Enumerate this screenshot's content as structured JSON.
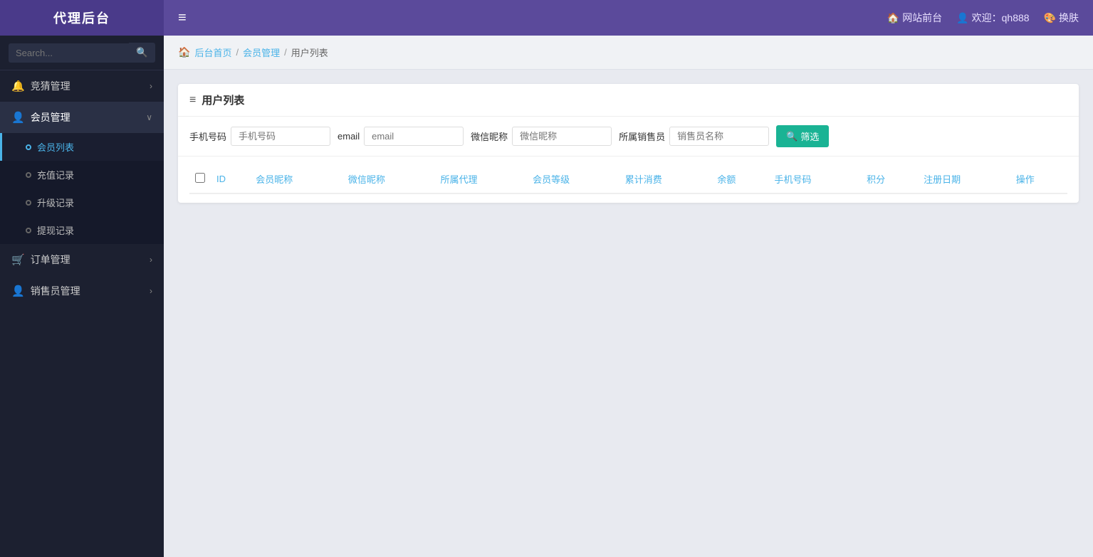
{
  "app": {
    "title": "代理后台"
  },
  "header": {
    "toggle_icon": "≡",
    "website_front": "网站前台",
    "welcome": "欢迎：qh888",
    "switch": "换肤"
  },
  "sidebar": {
    "search_placeholder": "Search...",
    "nav_items": [
      {
        "id": "jingsai",
        "label": "竞猜管理",
        "icon": "🔔",
        "has_arrow": true,
        "active": false
      },
      {
        "id": "huiyuan",
        "label": "会员管理",
        "icon": "👤",
        "has_arrow": true,
        "active": true,
        "children": [
          {
            "id": "huiyuan-list",
            "label": "会员列表",
            "active": true
          },
          {
            "id": "chongzhi",
            "label": "充值记录",
            "active": false
          },
          {
            "id": "shengji",
            "label": "升级记录",
            "active": false
          },
          {
            "id": "tixian",
            "label": "提现记录",
            "active": false
          }
        ]
      },
      {
        "id": "dingdan",
        "label": "订单管理",
        "icon": "🛒",
        "has_arrow": true,
        "active": false
      },
      {
        "id": "xiaoshou",
        "label": "销售员管理",
        "icon": "👤",
        "has_arrow": true,
        "active": false
      }
    ]
  },
  "breadcrumb": {
    "home_label": "后台首页",
    "sep1": "/",
    "level1": "会员管理",
    "sep2": "/",
    "current": "用户列表"
  },
  "page": {
    "title": "用户列表",
    "title_icon": "≡"
  },
  "filter": {
    "phone_label": "手机号码",
    "phone_placeholder": "手机号码",
    "email_label": "email",
    "email_placeholder": "email",
    "wechat_label": "微信昵称",
    "wechat_placeholder": "微信昵称",
    "salesman_label": "所属销售员",
    "salesman_placeholder": "销售员名称",
    "filter_btn": "筛选",
    "search_icon": "🔍"
  },
  "table": {
    "columns": [
      {
        "id": "checkbox",
        "label": ""
      },
      {
        "id": "id",
        "label": "ID"
      },
      {
        "id": "nickname",
        "label": "会员昵称"
      },
      {
        "id": "wechat",
        "label": "微信昵称"
      },
      {
        "id": "agent",
        "label": "所属代理"
      },
      {
        "id": "level",
        "label": "会员等级"
      },
      {
        "id": "total_spend",
        "label": "累计消费"
      },
      {
        "id": "balance",
        "label": "余额"
      },
      {
        "id": "phone",
        "label": "手机号码"
      },
      {
        "id": "points",
        "label": "积分"
      },
      {
        "id": "reg_date",
        "label": "注册日期"
      },
      {
        "id": "actions",
        "label": "操作"
      }
    ],
    "rows": []
  }
}
